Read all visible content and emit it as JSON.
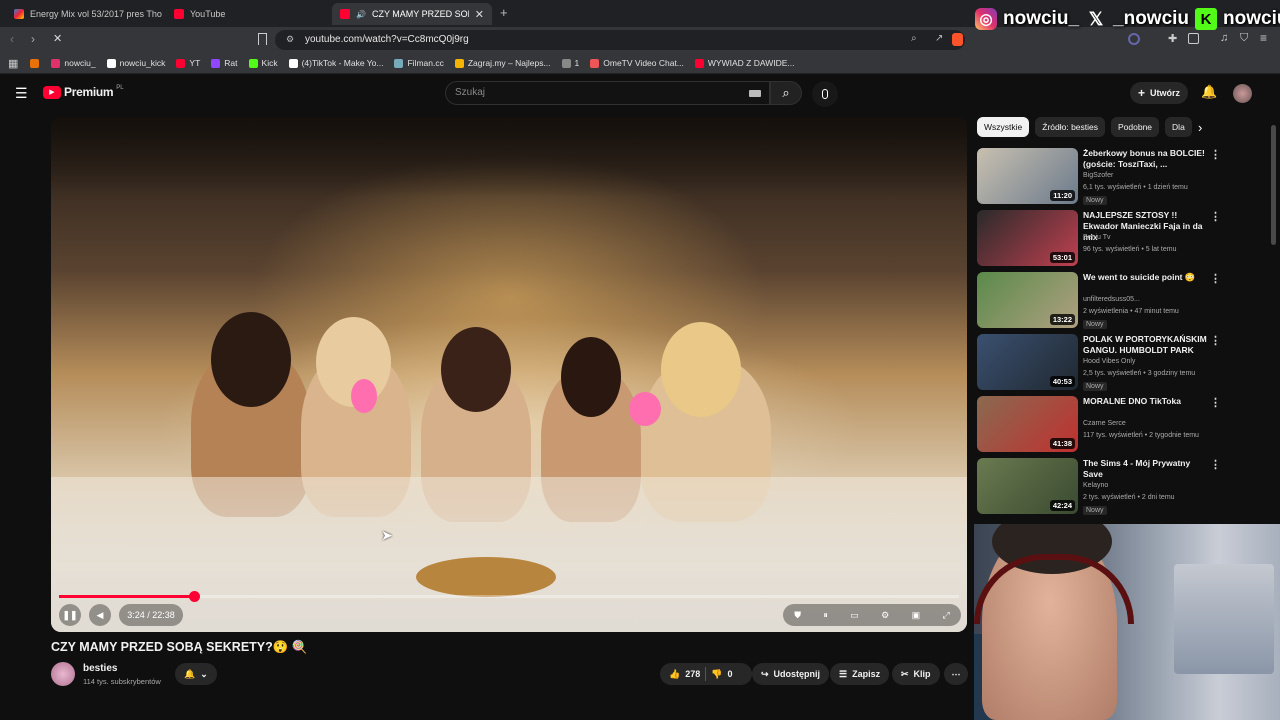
{
  "tabs": [
    {
      "label": "Energy Mix vol 53/2017 pres Tho",
      "active": false
    },
    {
      "label": "YouTube",
      "active": false
    },
    {
      "label": "CZY MAMY PRZED SOBĄ SEK",
      "active": true
    }
  ],
  "address": {
    "url": "youtube.com/watch?v=Cc8mcQ0j9rg"
  },
  "bookmarks": [
    {
      "label": "nowciu_",
      "color": "#e1306c"
    },
    {
      "label": "nowciu_kick",
      "color": "#ffffff"
    },
    {
      "label": "YT",
      "color": "#ff0033"
    },
    {
      "label": "Rat",
      "color": "#9146ff"
    },
    {
      "label": "Kick",
      "color": "#53fc18"
    },
    {
      "label": "(4)TikTok - Make Yo...",
      "color": "#ffffff"
    },
    {
      "label": "Filman.cc",
      "color": "#7ab"
    },
    {
      "label": "Zagraj.my – Najleps...",
      "color": "#f5b400"
    },
    {
      "label": "1",
      "color": "#888888"
    },
    {
      "label": "OmeTV Video Chat...",
      "color": "#e55"
    },
    {
      "label": "WYWIAD Z DAWIDE...",
      "color": "#ff0033"
    }
  ],
  "socials": {
    "instagram": "nowciu_",
    "x": "_nowciu",
    "kick": "nowciu"
  },
  "header": {
    "logo": "Premium",
    "region": "PL",
    "search_placeholder": "Szukaj",
    "create_label": "Utwórz"
  },
  "player": {
    "time": "3:24 / 22:38",
    "progress": 0.1503
  },
  "video": {
    "title": "CZY MAMY PRZED SOBĄ SEKRETY?😲 🍭",
    "channel": "besties",
    "subscribers": "114 tys. subskrybentów",
    "likes": "278",
    "dislikes": "0",
    "share_label": "Udostępnij",
    "save_label": "Zapisz",
    "clip_label": "Klip"
  },
  "chips": [
    "Wszystkie",
    "Źródło: besties",
    "Podobne",
    "Dla"
  ],
  "recommendations": [
    {
      "title": "Żeberkowy bonus na BOLCIE! (goście: ToszíTaxi, ...",
      "channel": "BigSzofer",
      "meta": "6,1 tys. wyświetleń • 1 dzień temu",
      "badge": "Nowy",
      "duration": "11:20",
      "thumb": [
        "#c8c0b0",
        "#6b7a8c"
      ]
    },
    {
      "title": "NAJLEPSZE SZTOSY !! Ekwador Manieczki Faja in da mix",
      "channel": "Beniu Tv",
      "meta": "96 tys. wyświetleń • 5 lat temu",
      "badge": "",
      "duration": "53:01",
      "thumb": [
        "#2a2a2a",
        "#c04050"
      ]
    },
    {
      "title": "We went to suicide point 😳",
      "channel": "unfilteredsuss05...",
      "meta": "2 wyświetlenia • 47 minut temu",
      "badge": "Nowy",
      "duration": "13:22",
      "thumb": [
        "#5a8a4a",
        "#b0a080"
      ]
    },
    {
      "title": "POLAK W PORTORYKAŃSKIM GANGU. HUMBOLDT PARK",
      "channel": "Hood Vibes Only",
      "meta": "2,5 tys. wyświetleń • 3 godziny temu",
      "badge": "Nowy",
      "duration": "40:53",
      "thumb": [
        "#3a5070",
        "#202830"
      ]
    },
    {
      "title": "MORALNE DNO TikToka",
      "channel": "Czarne Serce",
      "meta": "117 tys. wyświetleń • 2 tygodnie temu",
      "badge": "",
      "duration": "41:38",
      "thumb": [
        "#8a6a50",
        "#c03030"
      ]
    },
    {
      "title": "The Sims 4 - Mój Prywatny Save",
      "channel": "Kelayno",
      "meta": "2 tys. wyświetleń • 2 dni temu",
      "badge": "Nowy",
      "duration": "42:24",
      "thumb": [
        "#6a7a50",
        "#3a4a30"
      ]
    }
  ]
}
